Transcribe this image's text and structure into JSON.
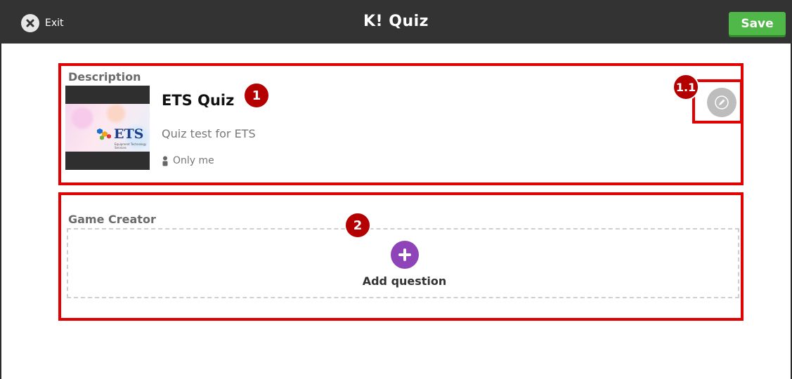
{
  "topbar": {
    "exit_label": "Exit",
    "brand_logo": "K!",
    "brand_label": "Quiz",
    "save_label": "Save",
    "save_color": "#4fb848"
  },
  "description": {
    "heading": "Description",
    "cover_logo_text": "ETS",
    "cover_logo_tagline": "Equipment Technology Services",
    "title": "ETS Quiz",
    "subtitle": "Quiz test for ETS",
    "visibility": "Only me",
    "edit_icon": "pencil-icon"
  },
  "game_creator": {
    "heading": "Game Creator",
    "add_question_label": "Add question",
    "add_icon": "plus-icon",
    "add_color": "#8e44b8"
  },
  "annotations": {
    "badge_1": "1",
    "badge_1_1": "1.1",
    "badge_2": "2",
    "highlight_color": "#e20000"
  }
}
